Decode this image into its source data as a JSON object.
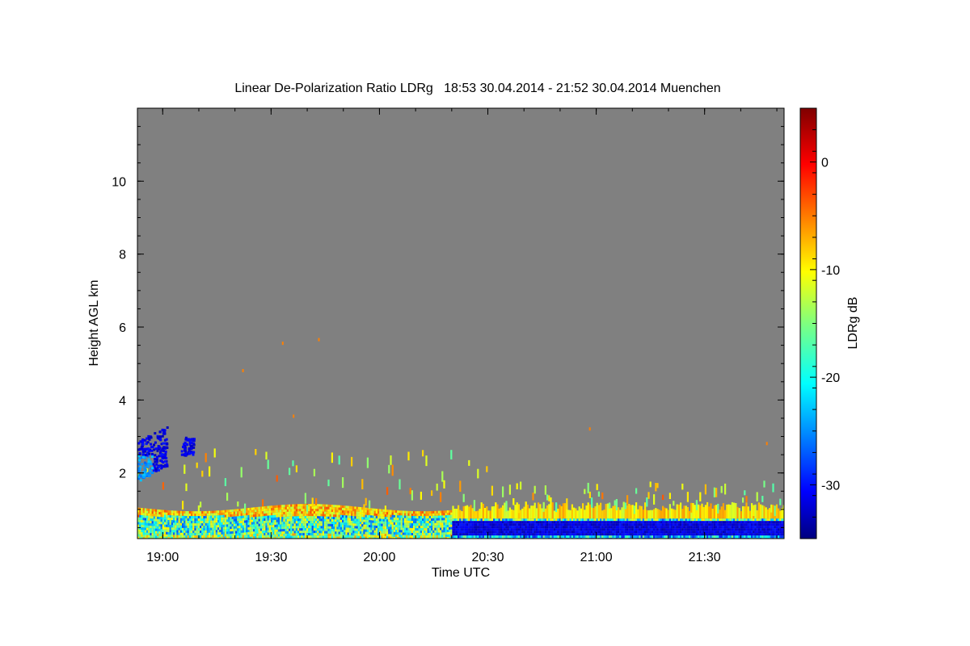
{
  "chart_data": {
    "type": "heatmap",
    "title": "Linear De-Polarization Ratio LDRg   18:53 30.04.2014 - 21:52 30.04.2014 Muenchen",
    "xlabel": "Time UTC",
    "ylabel": "Height AGL km",
    "colorbar_label": "LDRg dB",
    "x_range": [
      "18:53",
      "21:52"
    ],
    "y_range_km": [
      0.2,
      12
    ],
    "x_ticks": [
      {
        "label": "19:00",
        "minutes": 7
      },
      {
        "label": "19:30",
        "minutes": 37
      },
      {
        "label": "20:00",
        "minutes": 67
      },
      {
        "label": "20:30",
        "minutes": 97
      },
      {
        "label": "21:00",
        "minutes": 127
      },
      {
        "label": "21:30",
        "minutes": 157
      }
    ],
    "y_ticks": [
      {
        "label": "2",
        "value": 2
      },
      {
        "label": "4",
        "value": 4
      },
      {
        "label": "6",
        "value": 6
      },
      {
        "label": "8",
        "value": 8
      },
      {
        "label": "10",
        "value": 10
      }
    ],
    "colorbar_range_db": [
      -35,
      5
    ],
    "colorbar_ticks": [
      {
        "label": "0",
        "value": 0
      },
      {
        "label": "-10",
        "value": -10
      },
      {
        "label": "-20",
        "value": -20
      },
      {
        "label": "-30",
        "value": -30
      }
    ],
    "colormap": "jet",
    "background_color": "#808080",
    "features": [
      {
        "description": "patchy cloud",
        "time_range": [
          "18:53",
          "19:07"
        ],
        "height_km": [
          1.7,
          3.3
        ],
        "ldr_db": -28
      },
      {
        "description": "surface layer (mixed)",
        "time_range": [
          "18:53",
          "20:20"
        ],
        "height_km": [
          0.2,
          1.0
        ],
        "ldr_db": -18
      },
      {
        "description": "low layer (depolarizing low)",
        "time_range": [
          "20:20",
          "21:52"
        ],
        "height_km": [
          0.35,
          0.75
        ],
        "ldr_db": -31
      },
      {
        "description": "layer top (high LDR)",
        "time_range": [
          "20:20",
          "21:52"
        ],
        "height_km": [
          0.8,
          1.1
        ],
        "ldr_db": -8
      }
    ]
  }
}
